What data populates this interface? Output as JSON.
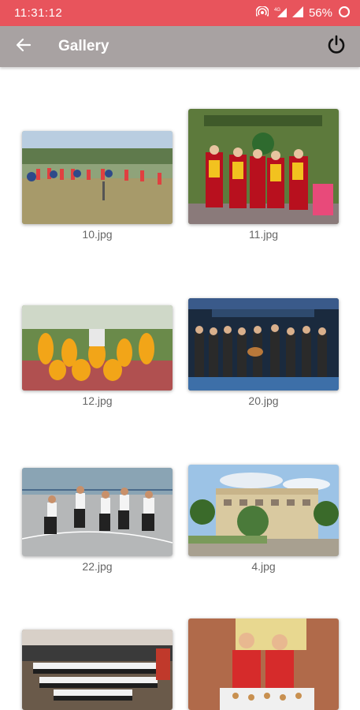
{
  "status_bar": {
    "time": "11:31:12",
    "battery": "56%",
    "icons": [
      "hotspot-icon",
      "4g-signal-icon",
      "signal-icon",
      "battery-icon"
    ]
  },
  "app_bar": {
    "title": "Gallery",
    "back_icon": "arrow-left-icon",
    "power_icon": "power-icon"
  },
  "gallery": {
    "items": [
      {
        "filename": "10.jpg"
      },
      {
        "filename": "11.jpg"
      },
      {
        "filename": "12.jpg"
      },
      {
        "filename": "20.jpg"
      },
      {
        "filename": "22.jpg"
      },
      {
        "filename": "4.jpg"
      },
      {
        "filename": "",
        "partial": true
      },
      {
        "filename": "",
        "partial": true
      }
    ]
  },
  "colors": {
    "status_bar": "#e8545c",
    "app_bar": "#a8a2a2",
    "caption_text": "#666666"
  }
}
